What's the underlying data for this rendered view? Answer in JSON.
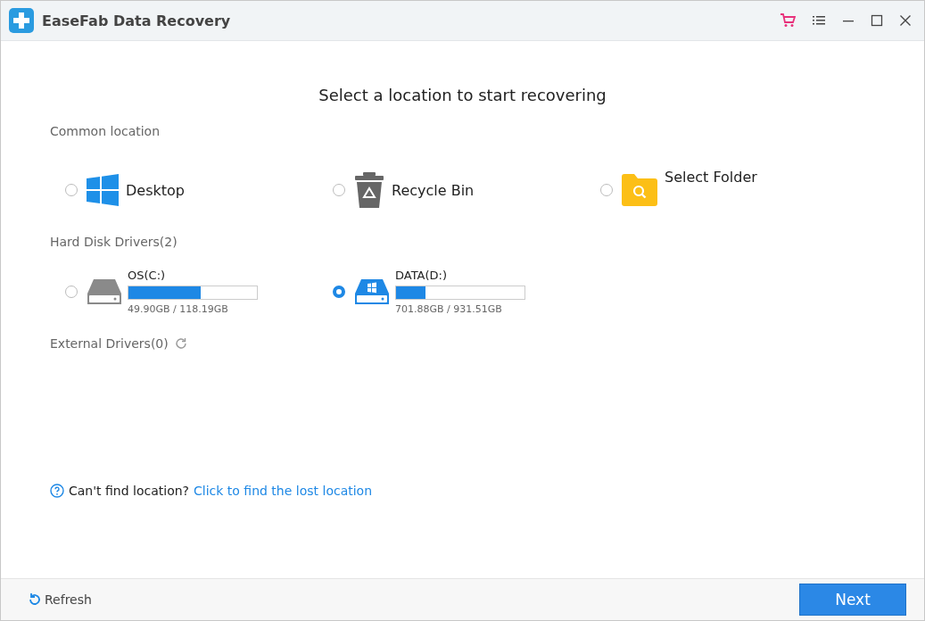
{
  "window": {
    "title": "EaseFab Data Recovery"
  },
  "heading": "Select a location to start recovering",
  "common": {
    "label": "Common location",
    "items": [
      {
        "kind": "desktop",
        "label": "Desktop",
        "selected": false
      },
      {
        "kind": "recycle",
        "label": "Recycle Bin",
        "selected": false
      },
      {
        "kind": "folder",
        "label": "Select Folder",
        "selected": false
      }
    ]
  },
  "hard_disks": {
    "label": "Hard Disk Drivers(2)",
    "items": [
      {
        "name": "OS(C:)",
        "level": 0.56,
        "usage": "49.90GB / 118.19GB",
        "selected": false
      },
      {
        "name": "DATA(D:)",
        "level": 0.23,
        "usage": "701.88GB / 931.51GB",
        "selected": true
      }
    ]
  },
  "external": {
    "label": "External Drivers(0)"
  },
  "help": {
    "question": "Can't find location?",
    "link": "Click to find the lost location"
  },
  "footer": {
    "refresh": "Refresh",
    "next": "Next"
  }
}
